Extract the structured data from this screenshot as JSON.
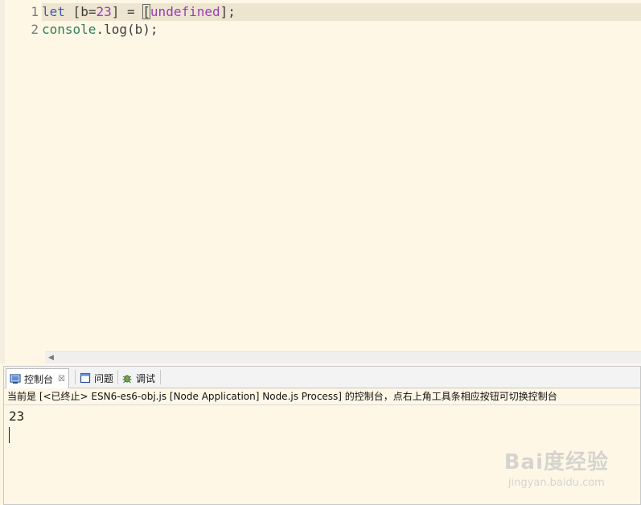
{
  "editor": {
    "line_numbers": [
      "1",
      "2"
    ],
    "line1": {
      "kw_let": "let",
      "space1": " ",
      "open": "[",
      "var_b": "b",
      "eq1": "=",
      "num": "23",
      "close": "]",
      "assign": " = ",
      "bracket_open": "[",
      "undefined": "undefined",
      "bracket_close": "];"
    },
    "line2": {
      "console": "console",
      "rest": ".log(b);"
    }
  },
  "console": {
    "tabs": [
      {
        "label": "控制台",
        "icon": "console-icon"
      },
      {
        "label": "问题",
        "icon": "problems-icon"
      },
      {
        "label": "调试",
        "icon": "debug-icon"
      }
    ],
    "close_glyph": "☒",
    "status": "当前是 [<已终止> ESN6-es6-obj.js [Node Application] Node.js Process] 的控制台，点右上角工具条相应按钮可切换控制台",
    "output": "23"
  },
  "watermark": {
    "logo": "Bai度经验",
    "sub": "jingyan.baidu.com"
  }
}
